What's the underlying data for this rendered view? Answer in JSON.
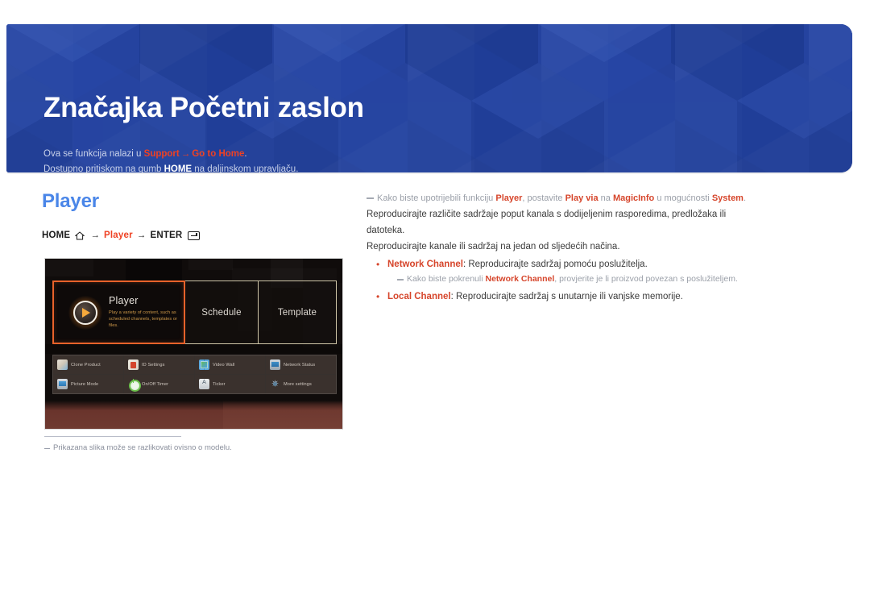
{
  "banner": {
    "title": "Značajka Početni zaslon",
    "subtitle_line1_pre": "Ova se funkcija nalazi u ",
    "subtitle_line1_link1": "Support",
    "subtitle_line1_arrow": "→",
    "subtitle_line1_link2": "Go to Home",
    "subtitle_line1_post": ".",
    "subtitle_line2_pre": "Dostupno pritiskom na gumb ",
    "subtitle_line2_key": "HOME",
    "subtitle_line2_post": " na daljinskom upravljaču.",
    "accent_blue": "#22419c",
    "accent_red": "#ef4123"
  },
  "section": {
    "title": "Player",
    "title_color": "#4a86e8",
    "breadcrumb": {
      "home": "HOME",
      "home_icon": "home-icon",
      "arrow1": "→",
      "target": "Player",
      "arrow2": "→",
      "enter": "ENTER",
      "enter_icon": "enter-key-icon"
    }
  },
  "tv_screen": {
    "tiles": [
      {
        "id": "player",
        "label": "Player",
        "description": "Play a variety of content, such as scheduled channels, templates or files.",
        "selected": true,
        "icon": "play-circle-icon"
      },
      {
        "id": "schedule",
        "label": "Schedule",
        "selected": false
      },
      {
        "id": "template",
        "label": "Template",
        "selected": false
      }
    ],
    "menu_items": [
      {
        "label": "Clone Product",
        "icon": "clone-product-icon"
      },
      {
        "label": "ID Settings",
        "icon": "id-settings-icon"
      },
      {
        "label": "Video Wall",
        "icon": "video-wall-icon"
      },
      {
        "label": "Network Status",
        "icon": "network-status-icon"
      },
      {
        "label": "Picture Mode",
        "icon": "picture-mode-icon"
      },
      {
        "label": "On/Off Timer",
        "icon": "on-off-timer-icon"
      },
      {
        "label": "Ticker",
        "icon": "ticker-icon"
      },
      {
        "label": "More settings",
        "icon": "more-settings-icon"
      }
    ],
    "selection_color": "#e8622a"
  },
  "caption": {
    "text": "Prikazana slika može se razlikovati ovisno o modelu."
  },
  "right_column": {
    "note_top": {
      "pre": "Kako biste upotrijebili funkciju ",
      "b1": "Player",
      "mid1": ", postavite ",
      "b2": "Play via",
      "mid2": " na ",
      "b3": "MagicInfo",
      "mid3": " u mogućnosti ",
      "b4": "System",
      "post": "."
    },
    "paragraph1": "Reproducirajte različite sadržaje poput kanala s dodijeljenim rasporedima, predložaka ili datoteka.",
    "paragraph2": "Reproducirajte kanale ili sadržaj na jedan od sljedećih načina.",
    "bullets": [
      {
        "bold": "Network Channel",
        "text": ": Reproducirajte sadržaj pomoću poslužitelja.",
        "subnote": {
          "pre": "Kako biste pokrenuli ",
          "bold": "Network Channel",
          "post": ", provjerite je li proizvod povezan s poslužiteljem."
        }
      },
      {
        "bold": "Local Channel",
        "text": ": Reproducirajte sadržaj s unutarnje ili vanjske memorije.",
        "subnote": null
      }
    ]
  }
}
